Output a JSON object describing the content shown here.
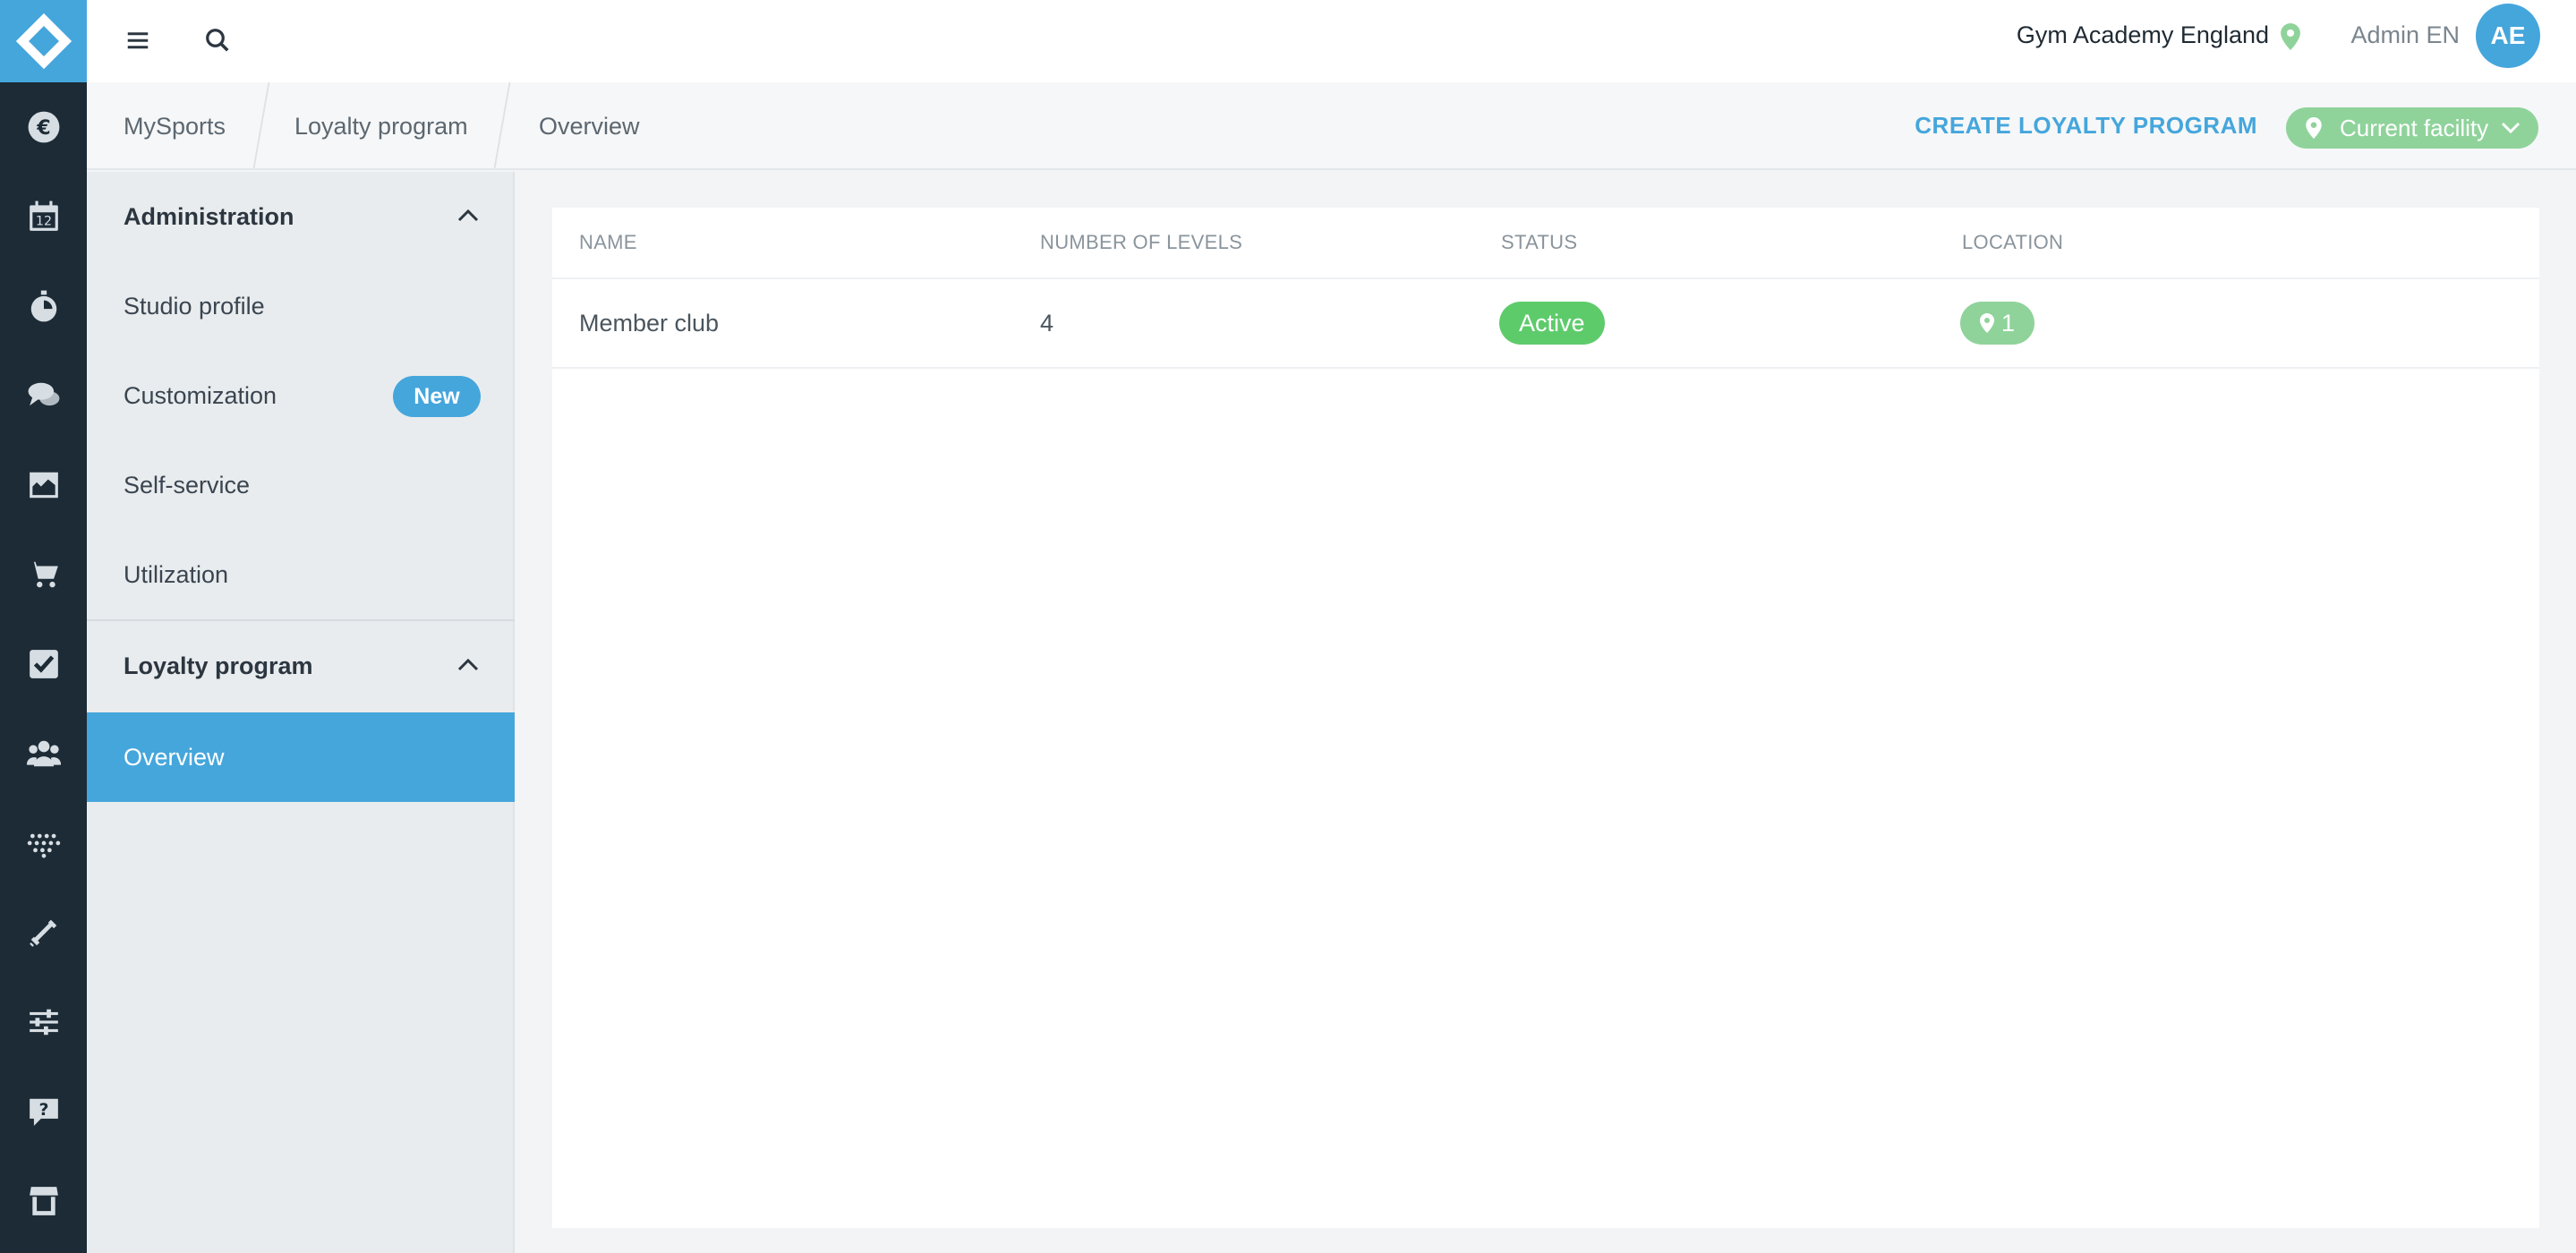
{
  "colors": {
    "rail_bg": "#1c2b36",
    "accent": "#45a6dc",
    "status_active": "#5ecb6b",
    "facility_green": "#8fd39b"
  },
  "rail": {
    "items": [
      {
        "icon": "euro-icon"
      },
      {
        "icon": "calendar-icon"
      },
      {
        "icon": "stopwatch-icon"
      },
      {
        "icon": "chat-icon"
      },
      {
        "icon": "chart-icon"
      },
      {
        "icon": "cart-icon"
      },
      {
        "icon": "checkbox-icon"
      },
      {
        "icon": "users-icon"
      },
      {
        "icon": "dots-grid-icon"
      },
      {
        "icon": "dumbbell-icon"
      },
      {
        "icon": "sliders-icon"
      },
      {
        "icon": "help-icon"
      },
      {
        "icon": "store-icon"
      }
    ]
  },
  "topbar": {
    "facility": "Gym Academy England",
    "user": "Admin EN",
    "avatar_initials": "AE"
  },
  "breadcrumb": [
    "MySports",
    "Loyalty program",
    "Overview"
  ],
  "actions": {
    "create": "CREATE LOYALTY PROGRAM",
    "facility_filter": "Current facility"
  },
  "sidebar": {
    "sections": [
      {
        "title": "Administration",
        "items": [
          {
            "label": "Studio profile"
          },
          {
            "label": "Customization",
            "badge": "New"
          },
          {
            "label": "Self-service"
          },
          {
            "label": "Utilization"
          }
        ]
      },
      {
        "title": "Loyalty program",
        "items": [
          {
            "label": "Overview",
            "active": true
          }
        ]
      }
    ]
  },
  "table": {
    "columns": [
      "NAME",
      "NUMBER OF LEVELS",
      "STATUS",
      "LOCATION"
    ],
    "rows": [
      {
        "name": "Member club",
        "levels": "4",
        "status": "Active",
        "location": "1"
      }
    ]
  }
}
